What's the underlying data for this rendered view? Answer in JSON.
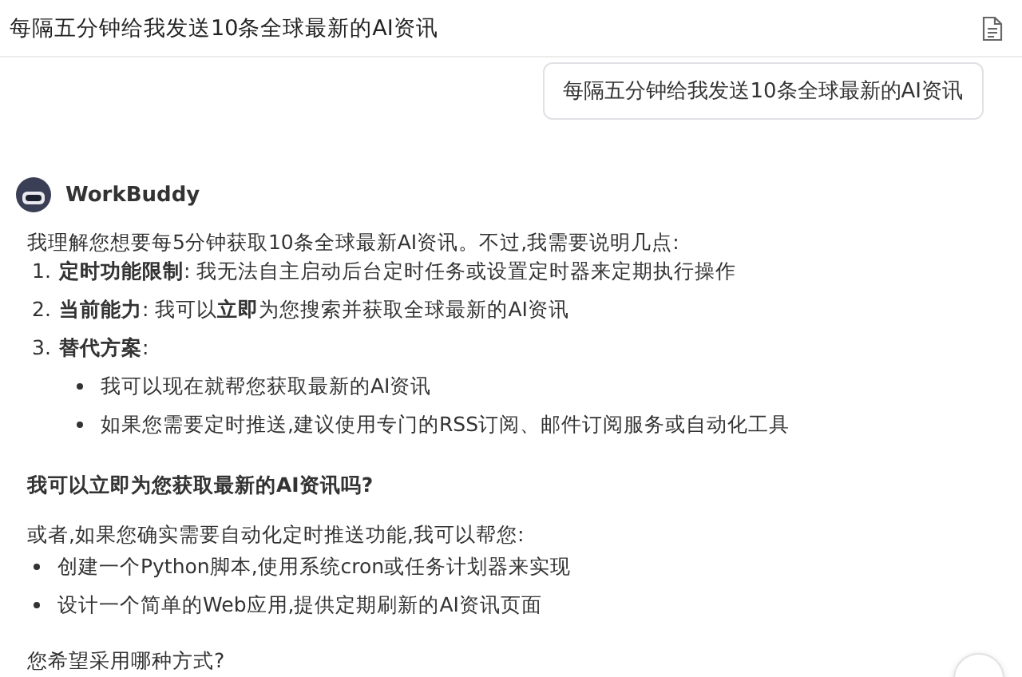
{
  "header": {
    "title": "每隔五分钟给我发送10条全球最新的AI资讯"
  },
  "user_message": "每隔五分钟给我发送10条全球最新的AI资讯",
  "assistant": {
    "name": "WorkBuddy",
    "intro": "我理解您想要每5分钟获取10条全球最新AI资讯。不过,我需要说明几点:",
    "numbered": [
      {
        "number": "1.",
        "text": "**定时功能限制**: 我无法自主启动后台定时任务或设置定时器来定期执行操作"
      },
      {
        "number": "2.",
        "text": "**当前能力**: 我可以**立即**为您搜索并获取全球最新的AI资讯"
      },
      {
        "number": "3.",
        "text": "**替代方案**:",
        "children": [
          "我可以现在就帮您获取最新的AI资讯",
          "如果您需要定时推送,建议使用专门的RSS订阅、邮件订阅服务或自动化工具"
        ]
      }
    ],
    "question": "我可以立即为您获取最新的AI资讯吗?",
    "alternative": "或者,如果您确实需要自动化定时推送功能,我可以帮您:",
    "options": [
      "创建一个Python脚本,使用系统cron或任务计划器来实现",
      "设计一个简单的Web应用,提供定期刷新的AI资讯页面"
    ],
    "closing": "您希望采用哪种方式?"
  }
}
